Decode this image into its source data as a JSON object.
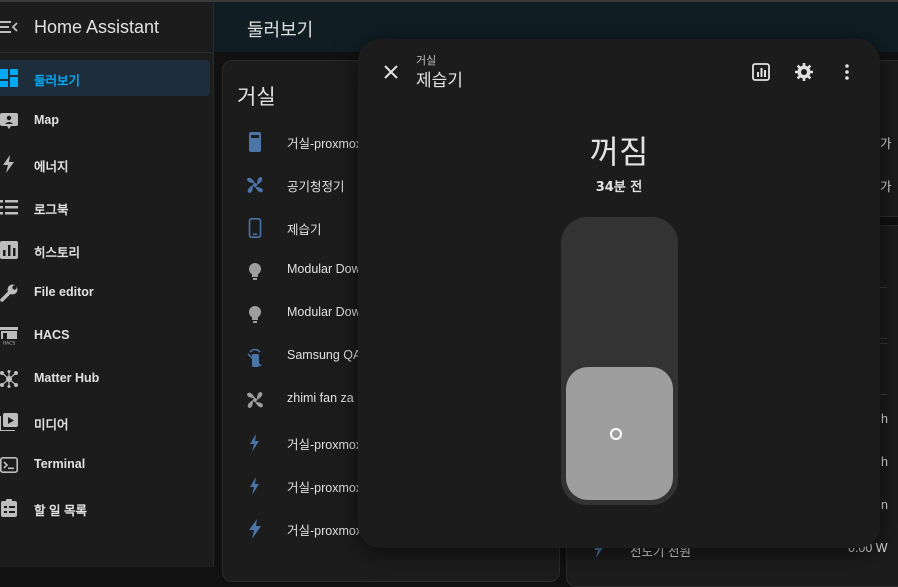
{
  "app": {
    "title": "Home Assistant"
  },
  "sidebar": {
    "items": [
      {
        "label": "둘러보기",
        "icon": "dashboard-icon",
        "active": true
      },
      {
        "label": "Map",
        "icon": "map-icon"
      },
      {
        "label": "에너지",
        "icon": "lightning-icon"
      },
      {
        "label": "로그북",
        "icon": "list-icon"
      },
      {
        "label": "히스토리",
        "icon": "chart-icon"
      },
      {
        "label": "File editor",
        "icon": "wrench-icon"
      },
      {
        "label": "HACS",
        "icon": "hacs-icon"
      },
      {
        "label": "Matter Hub",
        "icon": "hub-icon"
      },
      {
        "label": "미디어",
        "icon": "media-icon"
      },
      {
        "label": "Terminal",
        "icon": "terminal-icon"
      },
      {
        "label": "할 일 목록",
        "icon": "todo-icon"
      }
    ]
  },
  "header": {
    "title": "둘러보기"
  },
  "card": {
    "title": "거실",
    "rows": [
      {
        "label": "거실-proxmox",
        "icon": "server-icon"
      },
      {
        "label": "공기청정기",
        "icon": "fan-icon"
      },
      {
        "label": "제습기",
        "icon": "phone-icon"
      },
      {
        "label": "Modular Dow",
        "icon": "bulb-icon"
      },
      {
        "label": "Modular Dow",
        "icon": "bulb-icon"
      },
      {
        "label": "Samsung QA",
        "icon": "remote-icon"
      },
      {
        "label": "zhimi fan za",
        "icon": "fan-icon"
      },
      {
        "label": "거실-proxmox",
        "icon": "lightning-icon"
      },
      {
        "label": "거실-proxmox",
        "icon": "lightning-icon"
      },
      {
        "label": "거실-proxmox",
        "icon": "lightning-bold-icon"
      }
    ]
  },
  "right_peek": {
    "row1": "가",
    "row2": "가",
    "row3": "h",
    "row4": "h",
    "row5": "n",
    "bottom_label": "전도기 전원",
    "bottom_value": "0.00 W"
  },
  "dialog": {
    "area": "거실",
    "name": "제습기",
    "state": "꺼짐",
    "last_changed": "34분 전",
    "slider_level": 0.48,
    "icons": [
      "close-icon",
      "history-chart-icon",
      "settings-gear-icon",
      "more-vert-icon"
    ]
  },
  "colors": {
    "accent": "#03a9f4",
    "active_bg": "#1e2d3b",
    "icon_blue": "#4b74a7",
    "topbar": "#101e24"
  }
}
